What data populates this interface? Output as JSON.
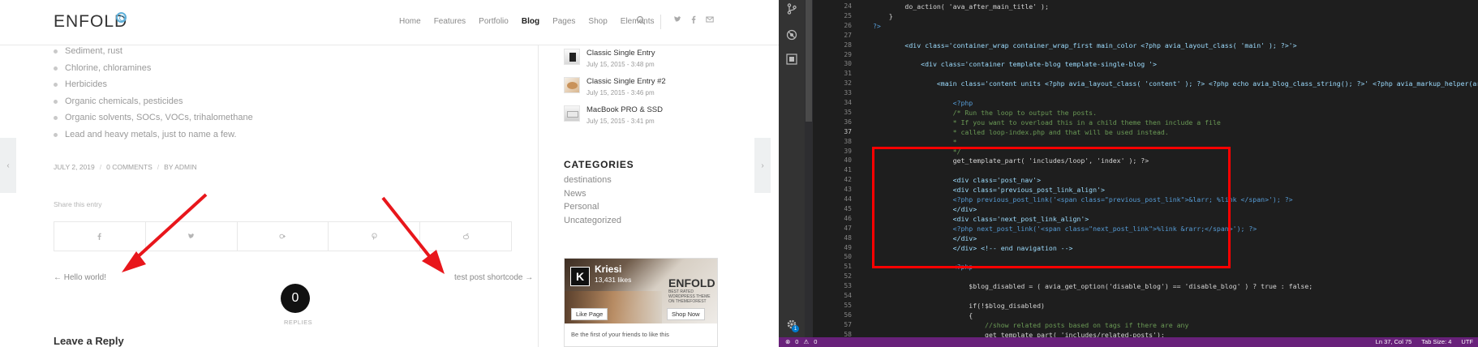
{
  "site": {
    "logo": "ENFOLD",
    "nav": [
      {
        "label": "Home",
        "active": false
      },
      {
        "label": "Features",
        "active": false
      },
      {
        "label": "Portfolio",
        "active": false
      },
      {
        "label": "Blog",
        "active": true
      },
      {
        "label": "Pages",
        "active": false
      },
      {
        "label": "Shop",
        "active": false
      },
      {
        "label": "Elements",
        "active": false
      }
    ],
    "bullets": [
      "Sediment, rust",
      "Chlorine, chloramines",
      "Herbicides",
      "Organic chemicals, pesticides",
      "Organic solvents, SOCs, VOCs, trihalomethane",
      "Lead and heavy metals, just to name a few."
    ],
    "post_meta": {
      "date": "JULY 2, 2019",
      "separator": "/",
      "comments": "0 COMMENTS",
      "author": "BY ADMIN"
    },
    "share_label": "Share this entry",
    "prev_link": "← Hello world!",
    "next_link": "test post shortcode →",
    "replies_count": "0",
    "replies_label": "REPLIES",
    "leave_reply": "Leave a Reply",
    "recent_posts": [
      {
        "title": "Classic Single Entry",
        "date": "July 15, 2015 - 3:48 pm"
      },
      {
        "title": "Classic Single Entry #2",
        "date": "July 15, 2015 - 3:46 pm"
      },
      {
        "title": "MacBook PRO & SSD",
        "date": "July 15, 2015 - 3:41 pm"
      }
    ],
    "categories_heading": "CATEGORIES",
    "categories": [
      "destinations",
      "News",
      "Personal",
      "Uncategorized"
    ],
    "facebook": {
      "page_name": "Kriesi",
      "likes": "13,431 likes",
      "brand": "ENFOLD",
      "brand_sub": "BEST RATED WORDPRESS THEME ON THEMEFOREST",
      "like_button": "Like Page",
      "shop_button": "Shop Now",
      "footer": "Be the first of your friends to like this"
    }
  },
  "editor": {
    "lines": [
      {
        "n": "24",
        "text": "        do_action( 'ava_after_main_title' );"
      },
      {
        "n": "25",
        "text": "    }"
      },
      {
        "n": "26",
        "text": "?>"
      },
      {
        "n": "27",
        "text": ""
      },
      {
        "n": "28",
        "text": "        <div class='container_wrap container_wrap_first main_color <?php avia_layout_class( 'main' ); ?>'>"
      },
      {
        "n": "29",
        "text": ""
      },
      {
        "n": "30",
        "text": "            <div class='container template-blog template-single-blog '>"
      },
      {
        "n": "31",
        "text": ""
      },
      {
        "n": "32",
        "text": "                <main class='content units <?php avia_layout_class( 'content' ); ?> <?php echo avia_blog_class_string(); ?>' <?php avia_markup_helper(array('context"
      },
      {
        "n": "33",
        "text": ""
      },
      {
        "n": "34",
        "text": "                    <?php"
      },
      {
        "n": "35",
        "text": "                    /* Run the loop to output the posts."
      },
      {
        "n": "36",
        "text": "                    * If you want to overload this in a child theme then include a file"
      },
      {
        "n": "37",
        "text": "                    * called loop-index.php and that will be used instead."
      },
      {
        "n": "38",
        "text": "                    *"
      },
      {
        "n": "39",
        "text": "                    */"
      },
      {
        "n": "40",
        "text": "                    get_template_part( 'includes/loop', 'index' ); ?>"
      },
      {
        "n": "41",
        "text": ""
      },
      {
        "n": "42",
        "text": "                    <div class='post_nav'>"
      },
      {
        "n": "43",
        "text": "                    <div class='previous_post_link_align'>"
      },
      {
        "n": "44",
        "text": "                    <?php previous_post_link('<span class=\"previous_post_link\">&larr; %link </span>'); ?>"
      },
      {
        "n": "45",
        "text": "                    </div>"
      },
      {
        "n": "46",
        "text": "                    <div class='next_post_link_align'>"
      },
      {
        "n": "47",
        "text": "                    <?php next_post_link('<span class=\"next_post_link\">%link &rarr;</span>'); ?>"
      },
      {
        "n": "48",
        "text": "                    </div>"
      },
      {
        "n": "49",
        "text": "                    </div> <!-- end navigation -->"
      },
      {
        "n": "50",
        "text": ""
      },
      {
        "n": "51",
        "text": "                    <?php"
      },
      {
        "n": "52",
        "text": ""
      },
      {
        "n": "53",
        "text": "                        $blog_disabled = ( avia_get_option('disable_blog') == 'disable_blog' ) ? true : false;"
      },
      {
        "n": "54",
        "text": ""
      },
      {
        "n": "55",
        "text": "                        if(!$blog_disabled)"
      },
      {
        "n": "56",
        "text": "                        {"
      },
      {
        "n": "57",
        "text": "                            //show related posts based on tags if there are any"
      },
      {
        "n": "58",
        "text": "                            get_template_part( 'includes/related-posts');"
      }
    ],
    "status": {
      "errors": "0",
      "warnings": "0",
      "position": "Ln 37, Col 75",
      "tab_size": "Tab Size: 4",
      "encoding": "UTF"
    },
    "badge": "1"
  },
  "colors": {
    "highlight": "#ff0000",
    "arrow": "#e8161b",
    "status_bar": "#68217a",
    "editor_bg": "#1e1e1e",
    "keyword": "#569cd6",
    "string": "#ce9178",
    "comment": "#6a9955"
  }
}
